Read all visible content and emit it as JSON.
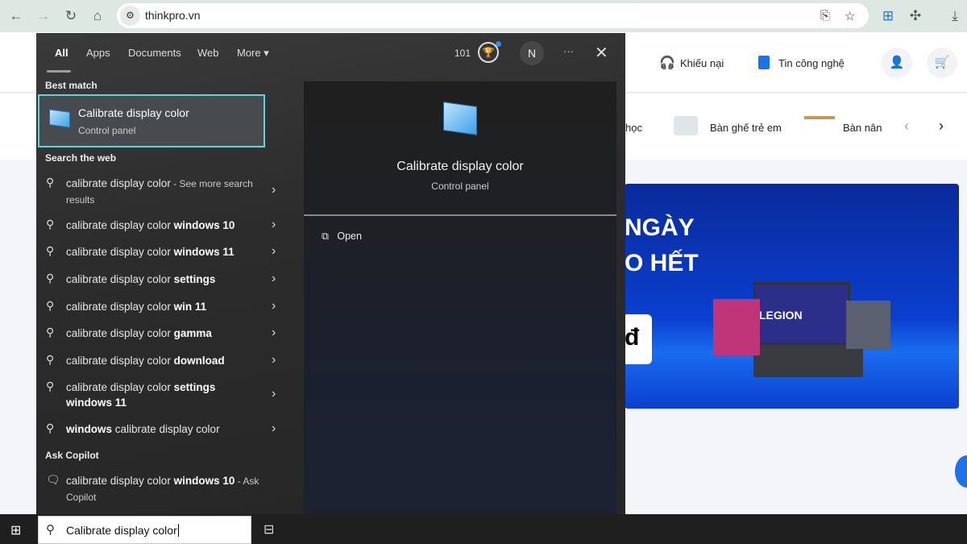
{
  "browser": {
    "url": "thinkpro.vn"
  },
  "site": {
    "complaints": "Khiếu nại",
    "tech_news": "Tin công nghệ",
    "categories": [
      "học",
      "Bàn ghế trẻ em",
      "Bàn nân"
    ],
    "banner_line1": "NGÀY",
    "banner_line2": "O HẾT",
    "banner_badge": "đ",
    "banner_laptop": "LEGION"
  },
  "search": {
    "tabs": [
      "All",
      "Apps",
      "Documents",
      "Web",
      "More"
    ],
    "points": "101",
    "avatar": "N",
    "more_label": "···",
    "best_match_label": "Best match",
    "best_match": {
      "title": "Calibrate display color",
      "subtitle": "Control panel"
    },
    "web_label": "Search the web",
    "web_results": [
      {
        "normal": "calibrate display color",
        "bold": "",
        "suffix": " - See more search results"
      },
      {
        "normal": "calibrate display color ",
        "bold": "windows 10",
        "suffix": ""
      },
      {
        "normal": "calibrate display color ",
        "bold": "windows 11",
        "suffix": ""
      },
      {
        "normal": "calibrate display color ",
        "bold": "settings",
        "suffix": ""
      },
      {
        "normal": "calibrate display color ",
        "bold": "win 11",
        "suffix": ""
      },
      {
        "normal": "calibrate display color ",
        "bold": "gamma",
        "suffix": ""
      },
      {
        "normal": "calibrate display color ",
        "bold": "download",
        "suffix": ""
      },
      {
        "normal": "calibrate display color ",
        "bold": "settings windows 11",
        "suffix": ""
      },
      {
        "normal": " calibrate display color",
        "bold": "windows",
        "suffix": ""
      }
    ],
    "copilot_label": "Ask Copilot",
    "copilot_item": {
      "normal": "calibrate display color ",
      "bold": "windows 10",
      "suffix": " - Ask Copilot"
    },
    "preview": {
      "title": "Calibrate display color",
      "subtitle": "Control panel",
      "open": "Open"
    },
    "query": "Calibrate display color"
  },
  "colors": {
    "accent": "#5fd5d9"
  }
}
